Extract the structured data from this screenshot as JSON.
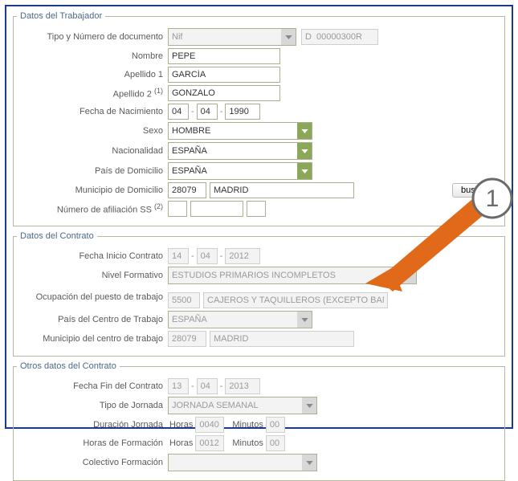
{
  "sections": {
    "worker": {
      "legend": "Datos del Trabajador"
    },
    "contract": {
      "legend": "Datos del Contrato"
    },
    "other": {
      "legend": "Otros datos del Contrato"
    }
  },
  "worker": {
    "doctype_label": "Tipo y Número de documento",
    "doctype_value": "Nif",
    "docnum_value": "D  00000300R",
    "name_label": "Nombre",
    "name_value": "PEPE",
    "surname1_label": "Apellido 1",
    "surname1_value": "GARCÍA",
    "surname2_label": "Apellido 2",
    "surname2_sup": "(1)",
    "surname2_value": "GONZALO",
    "birth_label": "Fecha de Nacimiento",
    "birth_d": "04",
    "birth_m": "04",
    "birth_y": "1990",
    "sex_label": "Sexo",
    "sex_value": "HOMBRE",
    "nat_label": "Nacionalidad",
    "nat_value": "ESPAÑA",
    "country_label": "País de Domicilio",
    "country_value": "ESPAÑA",
    "muni_label": "Municipio de Domicilio",
    "muni_code": "28079",
    "muni_name": "MADRID",
    "buscar": "buscar",
    "ssnum_label": "Número de afiliación SS",
    "ssnum_sup": "(2)"
  },
  "contract": {
    "start_label": "Fecha Inicio Contrato",
    "start_d": "14",
    "start_m": "04",
    "start_y": "2012",
    "edu_label": "Nivel Formativo",
    "edu_value": "ESTUDIOS PRIMARIOS INCOMPLETOS",
    "occ_label": "Ocupación del puesto de trabajo",
    "occ_code": "5500",
    "occ_text": "CAJEROS Y TAQUILLEROS (EXCEPTO BAN",
    "center_country_label": "País del Centro de Trabajo",
    "center_country_value": "ESPAÑA",
    "center_muni_label": "Municipio del centro de trabajo",
    "center_muni_code": "28079",
    "center_muni_name": "MADRID"
  },
  "other": {
    "end_label": "Fecha Fin del Contrato",
    "end_d": "13",
    "end_m": "04",
    "end_y": "2013",
    "daytype_label": "Tipo de Jornada",
    "daytype_value": "JORNADA SEMANAL",
    "duration_label": "Duración Jornada",
    "training_label": "Horas de Formación",
    "hours_label": "Horas",
    "mins_label": "Minutos",
    "duration_h": "0040",
    "duration_m": "00",
    "training_h": "0012",
    "training_m": "00",
    "collective_label": "Colectivo Formación"
  },
  "callout": {
    "number": "1"
  }
}
